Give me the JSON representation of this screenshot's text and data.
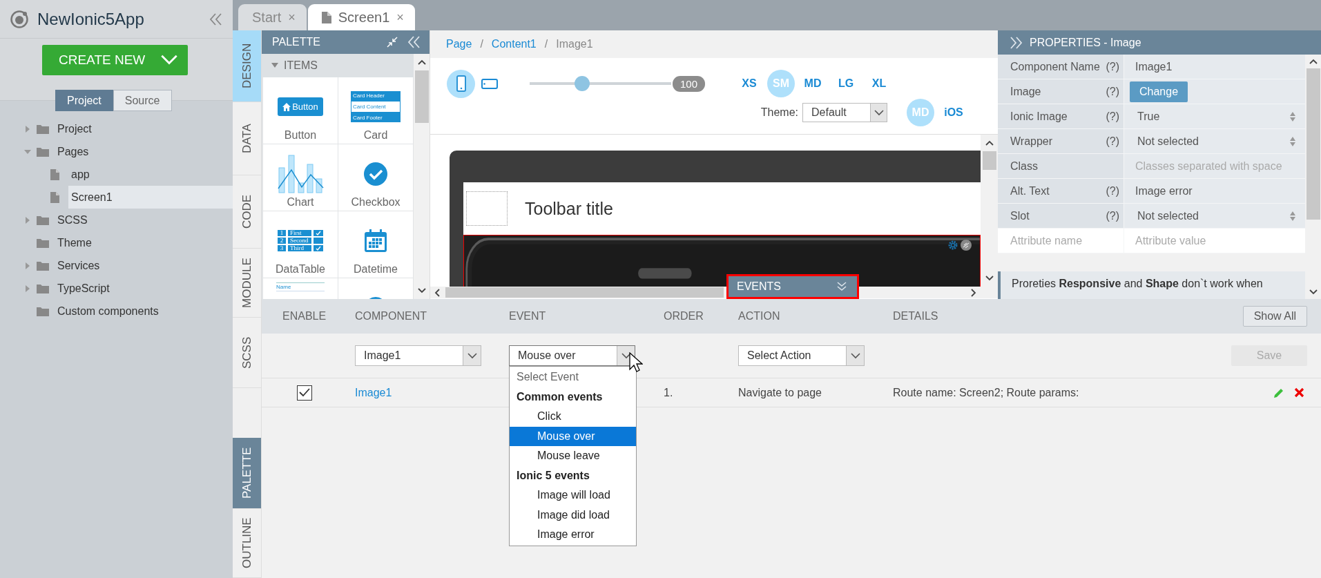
{
  "app": {
    "title": "NewIonic5App"
  },
  "create_button": {
    "label": "CREATE NEW"
  },
  "view_toggle": [
    {
      "label": "Project",
      "selected": true
    },
    {
      "label": "Source",
      "selected": false
    }
  ],
  "tree": [
    {
      "label": "Project",
      "kind": "folder",
      "expanded": false,
      "selected": false
    },
    {
      "label": "Pages",
      "kind": "folder",
      "expanded": true,
      "selected": false,
      "children": [
        {
          "label": "app",
          "kind": "file",
          "selected": false
        },
        {
          "label": "Screen1",
          "kind": "file",
          "selected": true
        }
      ]
    },
    {
      "label": "SCSS",
      "kind": "folder",
      "expanded": false,
      "selected": false
    },
    {
      "label": "Theme",
      "kind": "folder",
      "selected": false
    },
    {
      "label": "Services",
      "kind": "folder",
      "expanded": false,
      "selected": false
    },
    {
      "label": "TypeScript",
      "kind": "folder",
      "expanded": false,
      "selected": false
    },
    {
      "label": "Custom components",
      "kind": "folder",
      "selected": false
    }
  ],
  "editor_tabs": [
    {
      "label": "Start",
      "close": "×",
      "selected": false
    },
    {
      "label": "Screen1",
      "close": "×",
      "selected": true
    }
  ],
  "side_tabs": [
    {
      "label": "DESIGN",
      "selected": true
    },
    {
      "label": "DATA",
      "selected": false
    },
    {
      "label": "CODE",
      "selected": false
    },
    {
      "label": "MODULE",
      "selected": false
    },
    {
      "label": "SCSS",
      "selected": false
    }
  ],
  "bottom_tabs": [
    {
      "label": "PALETTE",
      "selected": true
    },
    {
      "label": "OUTLINE",
      "selected": false
    }
  ],
  "palette": {
    "title": "PALETTE",
    "section": {
      "label": "ITEMS",
      "expanded": true
    },
    "items": [
      {
        "label": "Button",
        "kind": "button",
        "preview": [
          "Button"
        ]
      },
      {
        "label": "Card",
        "kind": "card",
        "preview": [
          "Card Header",
          "Card Content",
          "Card Footer"
        ]
      },
      {
        "label": "Chart",
        "kind": "chart"
      },
      {
        "label": "Checkbox",
        "kind": "checkbox"
      },
      {
        "label": "DataTable",
        "kind": "datatable",
        "preview_rows": [
          {
            "number": "1",
            "text": "First",
            "checked": true
          },
          {
            "number": "2",
            "text": "Second",
            "checked": false
          },
          {
            "number": "3",
            "text": "Third",
            "checked": true
          }
        ]
      },
      {
        "label": "Datetime",
        "kind": "datetime"
      },
      {
        "kind": "form",
        "preview": [
          "Name"
        ]
      },
      {
        "kind": "radio"
      }
    ]
  },
  "canvas": {
    "breadcrumb": [
      {
        "label": "Page",
        "link": true
      },
      {
        "label": "Content1",
        "link": true
      },
      {
        "label": "Image1",
        "link": false
      }
    ],
    "separator": "/",
    "devices": [
      {
        "kind": "phone",
        "selected": true
      },
      {
        "kind": "tablet",
        "selected": false
      }
    ],
    "zoom": {
      "level": 0.37,
      "reading": "100"
    },
    "sizes": [
      {
        "label": "XS",
        "selected": false
      },
      {
        "label": "SM",
        "selected": true
      },
      {
        "label": "MD",
        "selected": false
      },
      {
        "label": "LG",
        "selected": false
      },
      {
        "label": "XL",
        "selected": false
      }
    ],
    "theme": {
      "label": "Theme:",
      "value": "Default"
    },
    "modes": [
      {
        "label": "MD",
        "selected": true
      },
      {
        "label": "iOS",
        "selected": false
      }
    ],
    "preview": {
      "toolbar_title": "Toolbar title"
    },
    "events_tab": {
      "label": "EVENTS"
    }
  },
  "properties": {
    "title": "PROPERTIES - Image",
    "rows": [
      {
        "label": "Component Name",
        "help": "(?)",
        "kind": "text",
        "value": "Image1"
      },
      {
        "label": "Image",
        "help": "(?)",
        "kind": "button",
        "value": "Change"
      },
      {
        "label": "Ionic Image",
        "help": "(?)",
        "kind": "select",
        "value": "True"
      },
      {
        "label": "Wrapper",
        "help": "(?)",
        "kind": "select",
        "value": "Not selected"
      },
      {
        "label": "Class",
        "kind": "input",
        "placeholder": "Classes separated with space"
      },
      {
        "label": "Alt. Text",
        "help": "(?)",
        "kind": "text",
        "value": "Image error"
      },
      {
        "label": "Slot",
        "help": "(?)",
        "kind": "select",
        "value": "Not selected"
      }
    ],
    "attribute": {
      "name_placeholder": "Attribute name",
      "value_placeholder": "Attribute value"
    },
    "note": "Proreties **Responsive** and **Shape** don`t work when"
  },
  "events": {
    "columns": [
      "ENABLE",
      "COMPONENT",
      "EVENT",
      "ORDER",
      "ACTION",
      "DETAILS"
    ],
    "show_all": "Show All",
    "form": {
      "component": "Image1",
      "event": "Mouse over",
      "event_open": true,
      "action_placeholder": "Select Action",
      "save": {
        "label": "Save",
        "disabled": true
      }
    },
    "rows": [
      {
        "enabled": true,
        "component": "Image1",
        "order": "1.",
        "action": "Navigate to page",
        "details": "Route name: Screen2; Route params:"
      }
    ],
    "options": [
      {
        "label": "Select Event",
        "kind": "placeholder"
      },
      {
        "label": "Common events",
        "kind": "group"
      },
      {
        "label": "Click",
        "kind": "option",
        "selected": false
      },
      {
        "label": "Mouse over",
        "kind": "option",
        "selected": true
      },
      {
        "label": "Mouse leave",
        "kind": "option",
        "selected": false
      },
      {
        "label": "Ionic 5 events",
        "kind": "group"
      },
      {
        "label": "Image will load",
        "kind": "option",
        "selected": false
      },
      {
        "label": "Image did load",
        "kind": "option",
        "selected": false
      },
      {
        "label": "Image error",
        "kind": "option",
        "selected": false
      }
    ]
  }
}
